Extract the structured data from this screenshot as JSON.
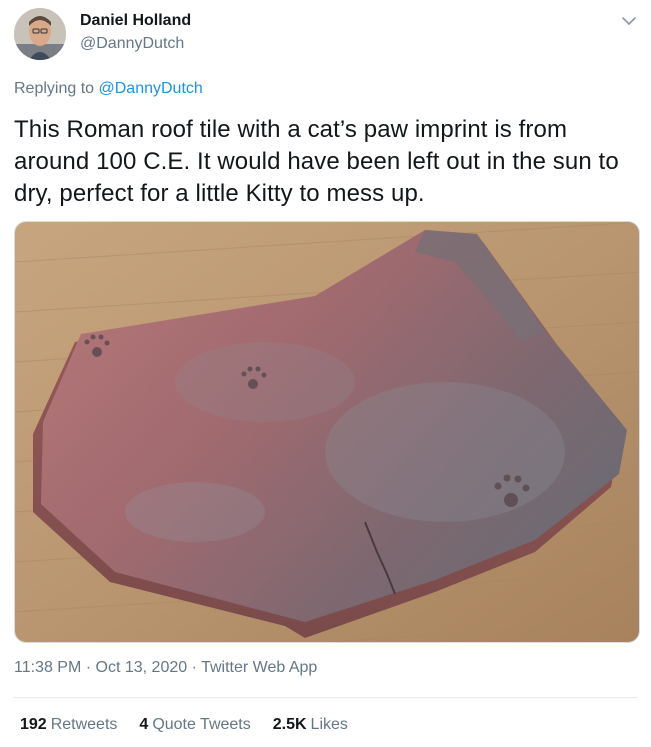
{
  "author": {
    "name": "Daniel Holland",
    "handle": "@DannyDutch",
    "avatar_icon": "avatar-photo"
  },
  "reply": {
    "prefix": "Replying to ",
    "handle": "@DannyDutch"
  },
  "tweet": {
    "text": "This Roman roof tile with a cat’s paw imprint is from around 100 C.E. It would have been left out in the sun to dry, perfect for a little Kitty to mess up.",
    "image_icon": "roof-tile-photo"
  },
  "meta": {
    "time": "11:38 PM",
    "sep1": " · ",
    "date": "Oct 13, 2020",
    "sep2": " · ",
    "source": "Twitter Web App"
  },
  "stats": {
    "retweets_count": "192",
    "retweets_label": "Retweets",
    "quotes_count": "4",
    "quotes_label": "Quote Tweets",
    "likes_count": "2.5K",
    "likes_label": "Likes"
  },
  "colors": {
    "link": "#1b95e0",
    "secondary": "#657786",
    "primary": "#14171a"
  }
}
